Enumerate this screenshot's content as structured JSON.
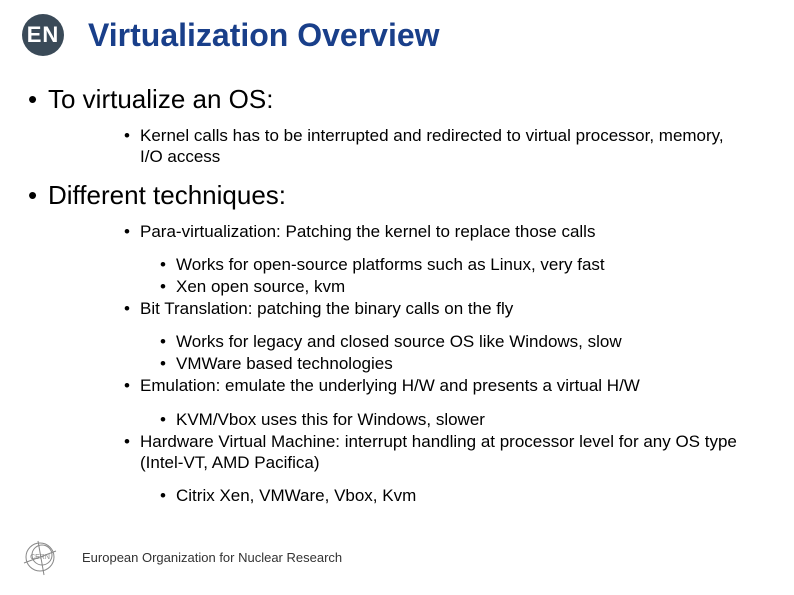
{
  "header": {
    "logo_text": "EN",
    "title": "Virtualization Overview"
  },
  "section1": {
    "heading": "To virtualize an OS:",
    "sub": [
      "Kernel calls has to be interrupted and redirected to virtual processor, memory, I/O access"
    ]
  },
  "section2": {
    "heading": "Different techniques:",
    "items": [
      {
        "text": "Para-virtualization: Patching the kernel to replace those calls",
        "sub": [
          "Works for open-source platforms such as Linux, very fast",
          "Xen open source, kvm"
        ]
      },
      {
        "text": "Bit Translation: patching the binary calls on the fly",
        "sub": [
          "Works for legacy and closed source OS like Windows, slow",
          "VMWare based technologies"
        ]
      },
      {
        "text": "Emulation: emulate the underlying H/W and presents a virtual H/W",
        "sub": [
          "KVM/Vbox uses this for Windows, slower"
        ]
      },
      {
        "text": "Hardware Virtual Machine: interrupt handling at processor level for any OS type (Intel-VT, AMD Pacifica)",
        "sub": [
          "Citrix Xen, VMWare, Vbox, Kvm"
        ]
      }
    ]
  },
  "footer": {
    "org": "European Organization for Nuclear Research"
  }
}
